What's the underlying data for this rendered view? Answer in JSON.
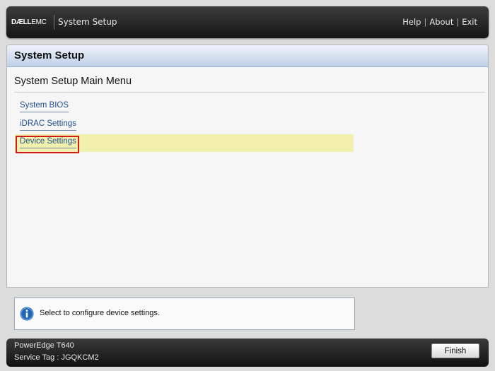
{
  "header": {
    "logo_bold": "DÆLL",
    "logo_thin": "EMC",
    "app_title": "System Setup",
    "links": {
      "help": "Help",
      "about": "About",
      "exit": "Exit",
      "separator": "|"
    }
  },
  "panel": {
    "title": "System Setup",
    "heading": "System Setup Main Menu",
    "menu": [
      {
        "label": "System BIOS"
      },
      {
        "label": "iDRAC Settings"
      },
      {
        "label": "Device Settings",
        "selected": true
      }
    ]
  },
  "help": {
    "icon": "info-icon",
    "text": "Select to configure device settings."
  },
  "footer": {
    "model": "PowerEdge T640",
    "service_tag": "Service Tag : JGQKCM2",
    "finish_label": "Finish"
  },
  "colors": {
    "selection_highlight": "#f1f0ad",
    "callout_border": "#d11a1a",
    "link_text": "#1f4f8f",
    "info_icon": "#1f66b8"
  }
}
